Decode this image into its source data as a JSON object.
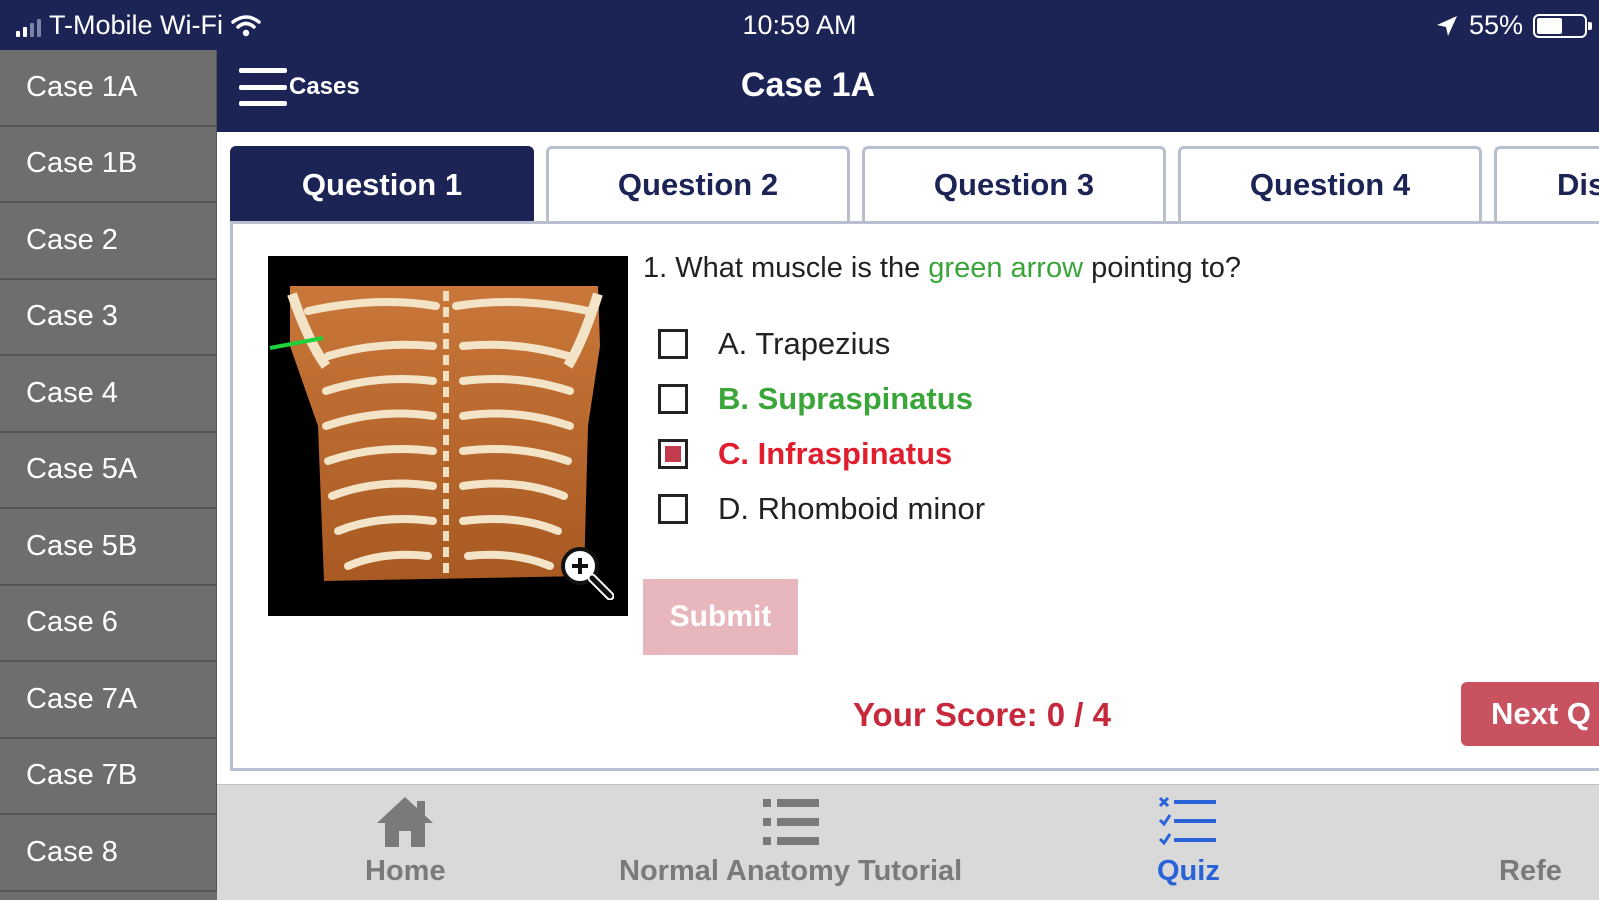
{
  "status": {
    "carrier": "T-Mobile Wi-Fi",
    "time": "10:59 AM",
    "battery_pct": "55%"
  },
  "sidebar": {
    "items": [
      {
        "label": "Case 1A"
      },
      {
        "label": "Case 1B"
      },
      {
        "label": "Case 2"
      },
      {
        "label": "Case 3"
      },
      {
        "label": "Case 4"
      },
      {
        "label": "Case 5A"
      },
      {
        "label": "Case 5B"
      },
      {
        "label": "Case 6"
      },
      {
        "label": "Case 7A"
      },
      {
        "label": "Case 7B"
      },
      {
        "label": "Case 8"
      }
    ]
  },
  "navbar": {
    "menu_label": "Cases",
    "title": "Case 1A"
  },
  "tabs": [
    {
      "label": "Question 1"
    },
    {
      "label": "Question 2"
    },
    {
      "label": "Question 3"
    },
    {
      "label": "Question 4"
    },
    {
      "label": "Dis"
    }
  ],
  "question": {
    "prefix": "1. What muscle is the ",
    "highlight": "green arrow",
    "suffix": " pointing to?",
    "answers": [
      {
        "label": "A. Trapezius"
      },
      {
        "label": "B. Supraspinatus"
      },
      {
        "label": "C. Infraspinatus"
      },
      {
        "label": "D. Rhomboid minor"
      }
    ]
  },
  "actions": {
    "submit_label": "Submit",
    "score": "Your Score: 0 / 4",
    "next_label": "Next Q"
  },
  "tabbar": {
    "items": [
      {
        "label": "Home"
      },
      {
        "label": "Normal Anatomy Tutorial"
      },
      {
        "label": "Quiz"
      },
      {
        "label": "Refe"
      }
    ]
  },
  "colors": {
    "navy": "#1c2456",
    "correct_green": "#3aa63a",
    "wrong_red": "#e01e2e",
    "active_tab_blue": "#2a63d9"
  }
}
